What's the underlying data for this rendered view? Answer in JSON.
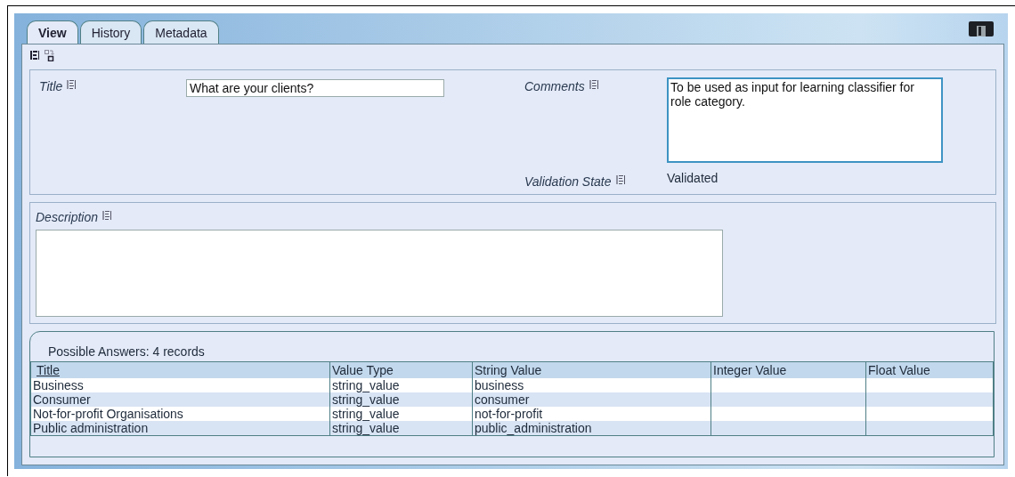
{
  "tabs": [
    {
      "label": "View",
      "selected": true
    },
    {
      "label": "History",
      "selected": false
    },
    {
      "label": "Metadata",
      "selected": false
    }
  ],
  "general": {
    "title_label": "Title",
    "title_value": "What are your clients?",
    "comments_label": "Comments",
    "comments_value": "To be used as input for learning classifier for role category.",
    "validation_label": "Validation State",
    "validation_value": "Validated"
  },
  "description": {
    "label": "Description"
  },
  "answers": {
    "caption": "Possible Answers: 4 records",
    "columns": [
      {
        "label": "Title",
        "sortable": true
      },
      {
        "label": "Value Type",
        "sortable": false
      },
      {
        "label": "String Value",
        "sortable": false
      },
      {
        "label": "Integer Value",
        "sortable": false
      },
      {
        "label": "Float Value",
        "sortable": false
      }
    ],
    "rows": [
      [
        "Business",
        "string_value",
        "business",
        "",
        ""
      ],
      [
        "Consumer",
        "string_value",
        "consumer",
        "",
        ""
      ],
      [
        "Not-for-profit Organisations",
        "string_value",
        "not-for-profit",
        "",
        ""
      ],
      [
        "Public administration",
        "string_value",
        "public_administration",
        "",
        ""
      ]
    ]
  }
}
